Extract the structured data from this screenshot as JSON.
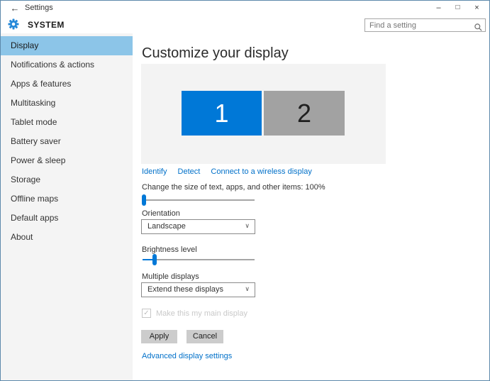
{
  "window": {
    "title": "Settings",
    "controls": {
      "minimize": "–",
      "maximize": "□",
      "close": "×"
    }
  },
  "icons": {
    "back": "←",
    "chevron_down": "∨",
    "check": "✓"
  },
  "header": {
    "page_title": "SYSTEM",
    "search": {
      "placeholder": "Find a setting"
    }
  },
  "sidebar": {
    "selected": "Display",
    "items": [
      {
        "label": "Display",
        "selected": true
      },
      {
        "label": "Notifications & actions",
        "selected": false
      },
      {
        "label": "Apps & features",
        "selected": false
      },
      {
        "label": "Multitasking",
        "selected": false
      },
      {
        "label": "Tablet mode",
        "selected": false
      },
      {
        "label": "Battery saver",
        "selected": false
      },
      {
        "label": "Power & sleep",
        "selected": false
      },
      {
        "label": "Storage",
        "selected": false
      },
      {
        "label": "Offline maps",
        "selected": false
      },
      {
        "label": "Default apps",
        "selected": false
      },
      {
        "label": "About",
        "selected": false
      }
    ]
  },
  "main": {
    "heading": "Customize your display",
    "monitors": [
      {
        "number": "1",
        "active": true
      },
      {
        "number": "2",
        "active": false
      }
    ],
    "links": {
      "identify": "Identify",
      "detect": "Detect",
      "connect": "Connect to a wireless display"
    },
    "size_slider": {
      "label": "Change the size of text, apps, and other items: 100%",
      "value_percent": 0
    },
    "orientation": {
      "label": "Orientation",
      "value": "Landscape"
    },
    "brightness": {
      "label": "Brightness level",
      "value_percent": 10
    },
    "multiple_displays": {
      "label": "Multiple displays",
      "value": "Extend these displays"
    },
    "main_display_checkbox": {
      "label": "Make this my main display",
      "checked": true,
      "disabled": true
    },
    "buttons": {
      "apply": "Apply",
      "cancel": "Cancel"
    },
    "advanced_link": "Advanced display settings"
  },
  "colors": {
    "accent": "#0078d7",
    "nav_selected": "#8cc5e8",
    "link": "#0070c9",
    "monitor_inactive": "#a2a2a2",
    "button_bg": "#cccccc",
    "window_border": "#5d89ab"
  }
}
